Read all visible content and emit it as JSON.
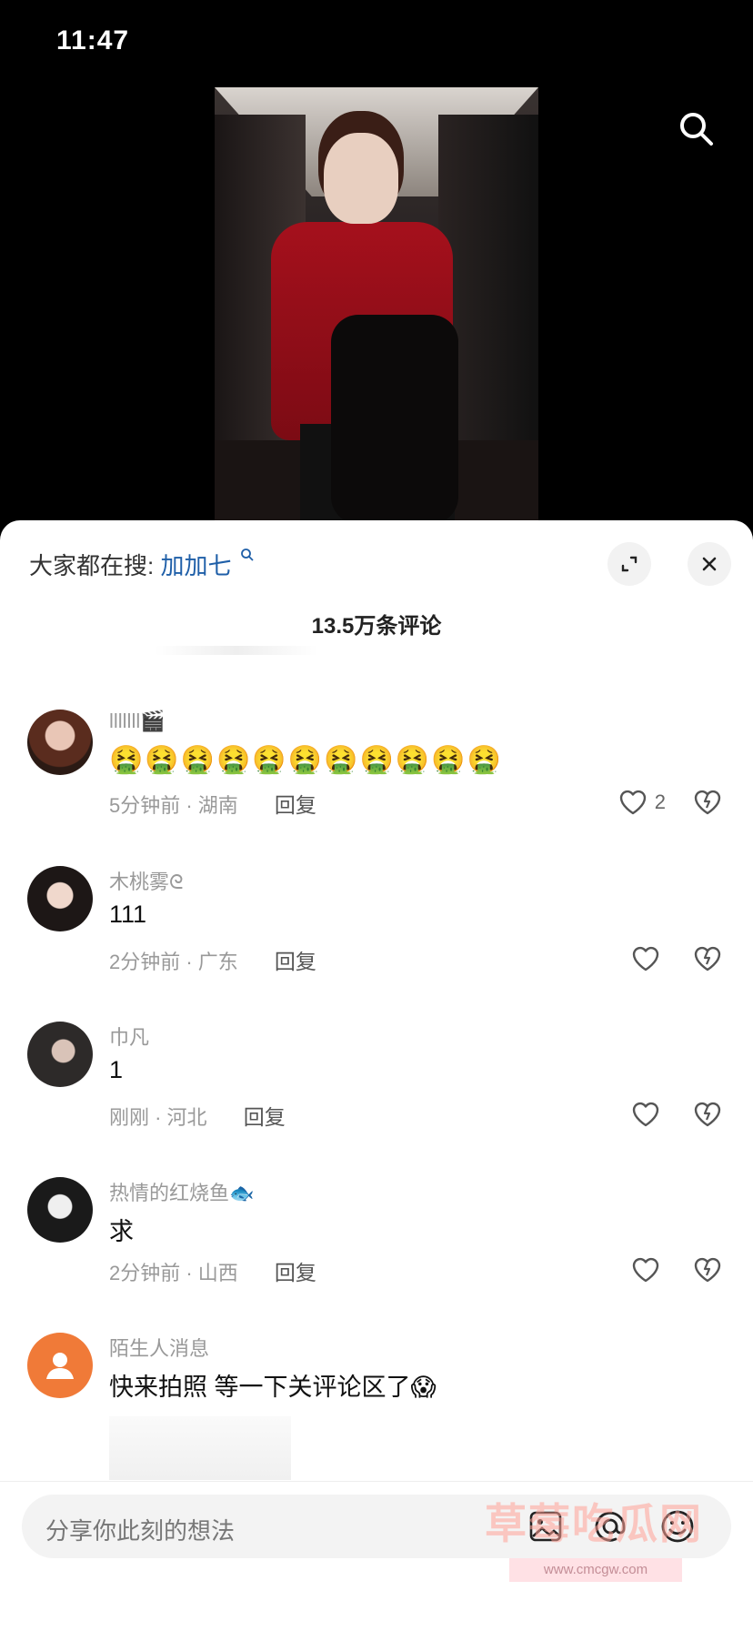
{
  "status": {
    "time": "11:47"
  },
  "panel": {
    "trend_prefix": "大家都在搜:",
    "trend_keyword": "加加七",
    "comment_count": "13.5万条评论"
  },
  "comments": [
    {
      "user": "lllllll🎬",
      "text": "🤮🤮🤮🤮🤮🤮🤮🤮🤮🤮🤮",
      "meta": "5分钟前 · 湖南",
      "reply": "回复",
      "likes": "2"
    },
    {
      "user": "木桃雾ᘓ",
      "text": "111",
      "meta": "2分钟前 · 广东",
      "reply": "回复",
      "likes": ""
    },
    {
      "user": "巾凡",
      "text": "1",
      "meta": "刚刚 · 河北",
      "reply": "回复",
      "likes": ""
    },
    {
      "user": "热情的红烧鱼🐟",
      "text": "求",
      "meta": "2分钟前 · 山西",
      "reply": "回复",
      "likes": ""
    },
    {
      "user": "陌生人消息",
      "text": "快来拍照 等一下关评论区了😱",
      "meta": "",
      "reply": "",
      "likes": ""
    }
  ],
  "composer": {
    "placeholder": "分享你此刻的想法"
  },
  "watermark": {
    "text": "草莓吃瓜网",
    "url": "www.cmcgw.com"
  },
  "icons": {
    "search": "search-icon",
    "expand": "expand-icon",
    "close": "close-icon",
    "like": "heart-icon",
    "dislike": "broken-heart-icon",
    "image": "image-icon",
    "mention": "at-icon",
    "emoji": "emoji-icon"
  }
}
